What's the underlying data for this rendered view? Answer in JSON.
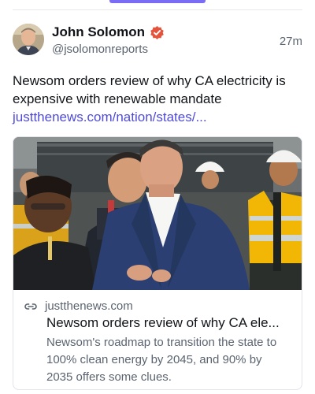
{
  "author": {
    "name": "John Solomon",
    "handle": "@jsolomonreports",
    "verified": true,
    "avatar": "avatar-photo"
  },
  "post": {
    "timestamp": "27m",
    "text": "Newsom orders review of why CA electricity is expensive with renewable mandate",
    "link": "justthenews.com/nation/states/..."
  },
  "link_card": {
    "image": "photo-newsom-with-workers",
    "domain": "justthenews.com",
    "title": "Newsom orders review of why CA ele...",
    "description": "Newsom's roadmap to transition the state to 100% clean energy by 2045, and 90% by 2035 offers some clues."
  },
  "colors": {
    "accent": "#7b6cf6",
    "link": "#4f4bd8",
    "verified": "#e5533d"
  }
}
